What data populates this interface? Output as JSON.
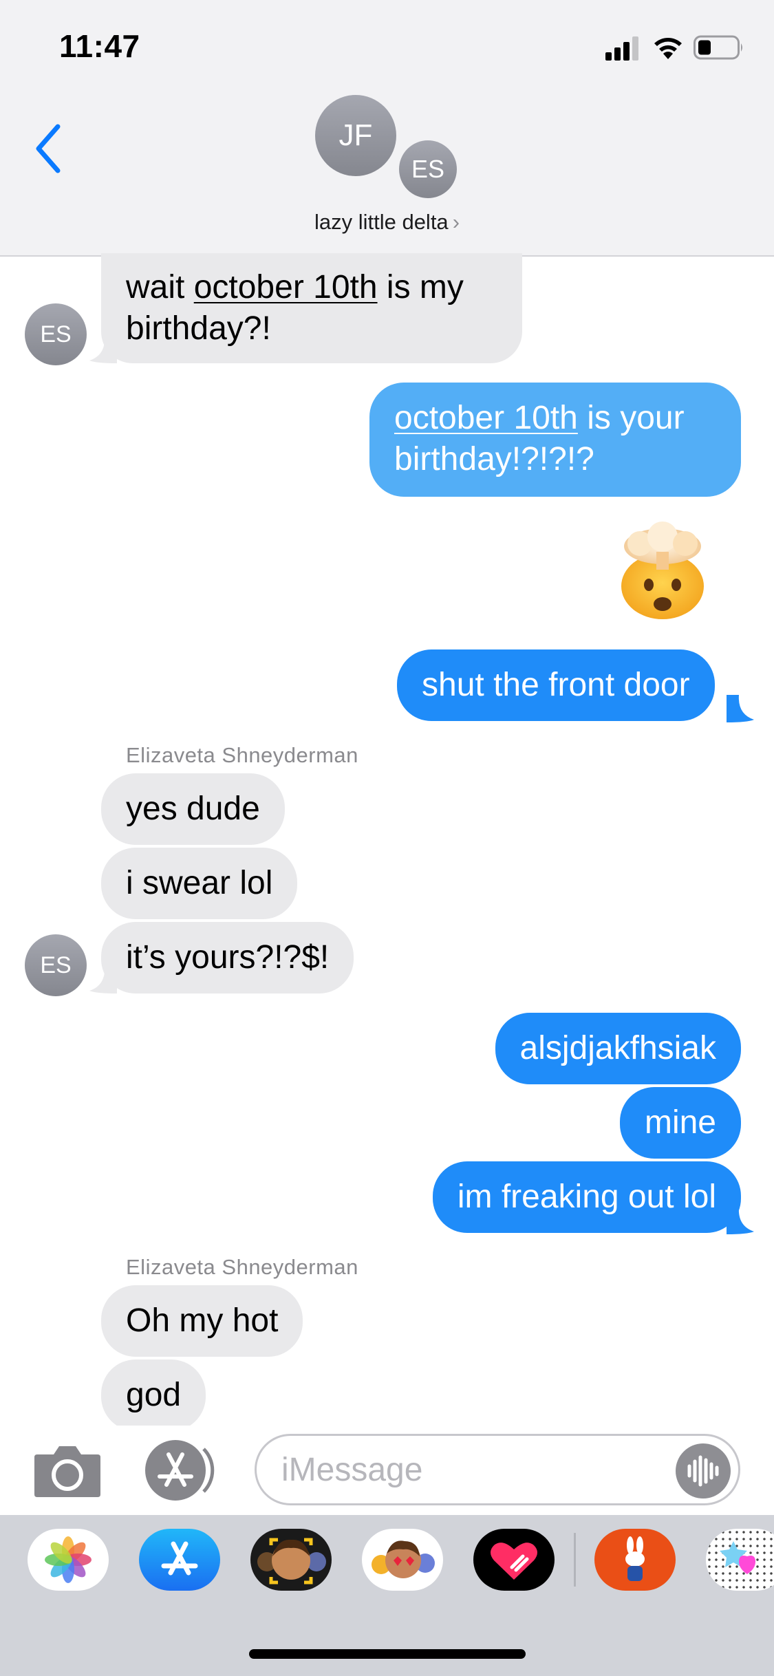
{
  "status_bar": {
    "time": "11:47"
  },
  "header": {
    "avatars": [
      "JF",
      "ES"
    ],
    "group_name": "lazy little delta",
    "chevron": "›"
  },
  "messages": [
    {
      "id": "m1",
      "direction": "incoming",
      "avatar": "ES",
      "segments": [
        {
          "text": "wait ",
          "link": false
        },
        {
          "text": "october 10th",
          "link": true
        },
        {
          "text": " is my",
          "link": false
        }
      ],
      "line2": "birthday?!"
    },
    {
      "id": "m2",
      "direction": "outgoing",
      "segments": [
        {
          "text": "october 10th",
          "link": true
        },
        {
          "text": " is your",
          "link": false
        }
      ],
      "line2": "birthday!?!?!?"
    },
    {
      "id": "m3",
      "direction": "outgoing",
      "emoji": "exploding-head"
    },
    {
      "id": "m4",
      "direction": "outgoing",
      "text": "shut the front door"
    },
    {
      "id": "m5",
      "direction": "incoming",
      "sender": "Elizaveta Shneyderman",
      "text": "yes dude"
    },
    {
      "id": "m6",
      "direction": "incoming",
      "text": "i swear lol"
    },
    {
      "id": "m7",
      "direction": "incoming",
      "avatar": "ES",
      "text": "it’s yours?!?$!"
    },
    {
      "id": "m8",
      "direction": "outgoing",
      "text": "alsjdjakfhsiak"
    },
    {
      "id": "m9",
      "direction": "outgoing",
      "text": "mine"
    },
    {
      "id": "m10",
      "direction": "outgoing",
      "text": "im freaking out lol"
    },
    {
      "id": "m11",
      "direction": "incoming",
      "sender": "Elizaveta Shneyderman",
      "text": "Oh my hot"
    },
    {
      "id": "m12",
      "direction": "incoming",
      "text": "god"
    }
  ],
  "input": {
    "placeholder": "iMessage"
  },
  "icons": {
    "back": "chevron-left-icon",
    "camera": "camera-icon",
    "apps": "app-store-icon",
    "audio": "waveform-icon",
    "signal": "cellular-signal-icon",
    "wifi": "wifi-icon",
    "battery": "battery-icon"
  },
  "app_drawer": [
    "Photos",
    "App Store",
    "Memoji",
    "Memoji Stickers",
    "Digital Touch",
    "Miffy",
    "Stickers"
  ],
  "colors": {
    "outgoing": "#1f8cf9",
    "incoming": "#e9e9eb",
    "accent": "#0a84ff"
  }
}
